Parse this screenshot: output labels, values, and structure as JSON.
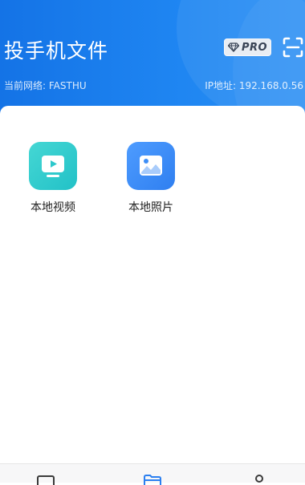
{
  "header": {
    "title": "投手机文件",
    "pro_badge": "PRO",
    "network_label": "当前网络: FASTHU",
    "ip_label": "IP地址: 192.168.0.56"
  },
  "tiles": [
    {
      "label": "本地视频",
      "icon": "video-icon"
    },
    {
      "label": "本地照片",
      "icon": "photo-icon"
    }
  ],
  "bottom_nav": [
    {
      "icon": "device-icon",
      "active": false
    },
    {
      "icon": "folder-icon",
      "active": true
    },
    {
      "icon": "profile-icon",
      "active": false
    }
  ],
  "colors": {
    "header_blue": "#1677e8",
    "video_teal": "#2cc8cc",
    "photo_blue": "#3d8ef7",
    "nav_active": "#2b7ff0"
  }
}
